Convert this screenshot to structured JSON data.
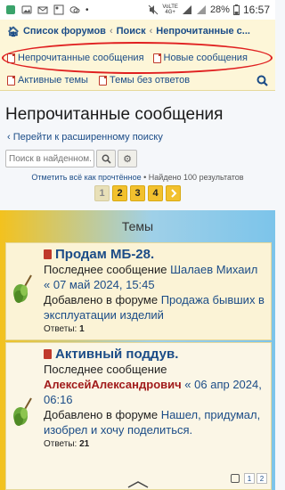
{
  "statusbar": {
    "network": "VoLTE",
    "network_type": "4G+",
    "battery": "28%",
    "time": "16:57"
  },
  "breadcrumb": {
    "items": [
      "Список форумов",
      "Поиск",
      "Непрочитанные с..."
    ]
  },
  "quicklinks": {
    "unread": "Непрочитанные сообщения",
    "new": "Новые сообщения",
    "active": "Активные темы",
    "unanswered": "Темы без ответов"
  },
  "page": {
    "title": "Непрочитанные сообщения",
    "advanced_search": "Перейти к расширенному поиску",
    "search_placeholder": "Поиск в найденном...",
    "mark_read": "Отметить всё как прочтённое",
    "found": "Найдено 100 результатов"
  },
  "pagination": {
    "pages": [
      "1",
      "2",
      "3",
      "4"
    ],
    "current": "1"
  },
  "topics": {
    "header": "Темы",
    "items": [
      {
        "title": "Продам МБ-28.",
        "last_post_label": "Последнее сообщение",
        "author": "Шалаев Михаил",
        "date": "« 07 май 2024, 15:45",
        "added_label": "Добавлено в форуме",
        "forum": "Продажа бывших в эксплуатации изделий",
        "replies_label": "Ответы:",
        "replies": "1"
      },
      {
        "title": "Активный поддув.",
        "last_post_label": "Последнее сообщение",
        "author": "АлексейАлександрович",
        "date": "« 06 апр 2024, 06:16",
        "added_label": "Добавлено в форуме",
        "forum": "Нашел, придумал, изобрел и хочу поделиться.",
        "replies_label": "Ответы:",
        "replies": "21",
        "pages": [
          "1",
          "2"
        ]
      }
    ]
  },
  "colors": {
    "link": "#1b4c87",
    "nav_bg": "#fdf6d8",
    "accent": "#f2c12e",
    "annotation": "#e02020",
    "author_red": "#a11b1b"
  }
}
